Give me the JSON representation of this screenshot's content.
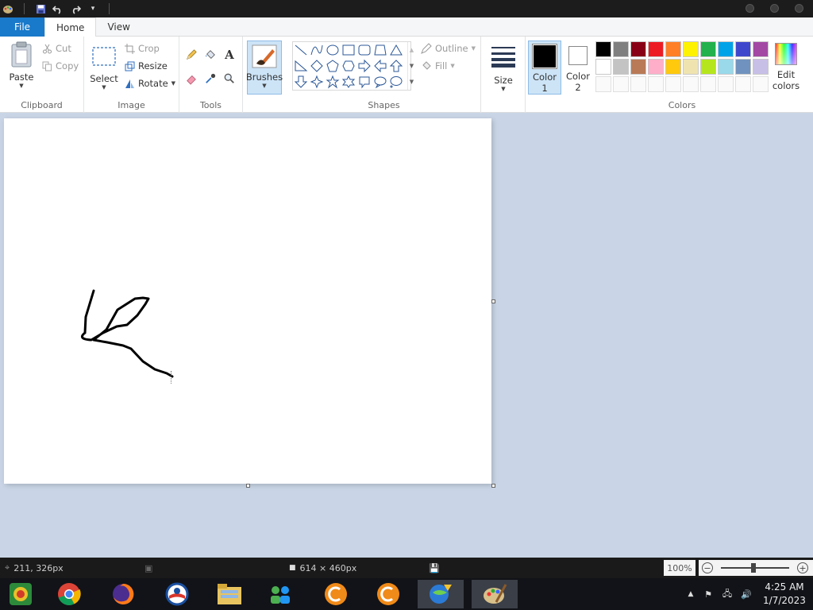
{
  "titlebar": {
    "quick_access": [
      "paint-app-icon",
      "save-icon",
      "undo-icon",
      "redo-icon",
      "customize-icon"
    ]
  },
  "tabs": {
    "file": "File",
    "home": "Home",
    "view": "View"
  },
  "ribbon": {
    "clipboard": {
      "label": "Clipboard",
      "paste": "Paste",
      "cut": "Cut",
      "copy": "Copy"
    },
    "image": {
      "label": "Image",
      "select": "Select",
      "crop": "Crop",
      "resize": "Resize",
      "rotate": "Rotate"
    },
    "tools": {
      "label": "Tools"
    },
    "brushes": {
      "label": "Brushes"
    },
    "shapes": {
      "label": "Shapes",
      "outline": "Outline",
      "fill": "Fill"
    },
    "size": {
      "label": "Size"
    },
    "color1": {
      "line1": "Color",
      "line2": "1",
      "value": "#000000"
    },
    "color2": {
      "line1": "Color",
      "line2": "2",
      "value": "#ffffff"
    },
    "colors": {
      "label": "Colors",
      "row1": [
        "#000000",
        "#7f7f7f",
        "#880015",
        "#ed1c24",
        "#ff7f27",
        "#fff200",
        "#22b14c",
        "#00a2e8",
        "#3f48cc",
        "#a349a4"
      ],
      "row2": [
        "#ffffff",
        "#c3c3c3",
        "#b97a57",
        "#ffaec9",
        "#ffc90e",
        "#efe4b0",
        "#b5e61d",
        "#99d9ea",
        "#7092be",
        "#c8bfe7"
      ]
    },
    "edit_colors": {
      "line1": "Edit",
      "line2": "colors"
    }
  },
  "status": {
    "cursor_position": "211, 326px",
    "canvas_size": "614 × 460px",
    "zoom": "100%"
  },
  "taskbar": {
    "apps": [
      "start-button",
      "chrome-icon",
      "firefox-icon",
      "obama-app-icon",
      "file-explorer-icon",
      "network-people-icon",
      "ccleaner-icon",
      "ccleaner-alt-icon",
      "internet-download-manager-icon",
      "paint-icon"
    ],
    "time": "4:25 AM",
    "date": "1/7/2023"
  }
}
